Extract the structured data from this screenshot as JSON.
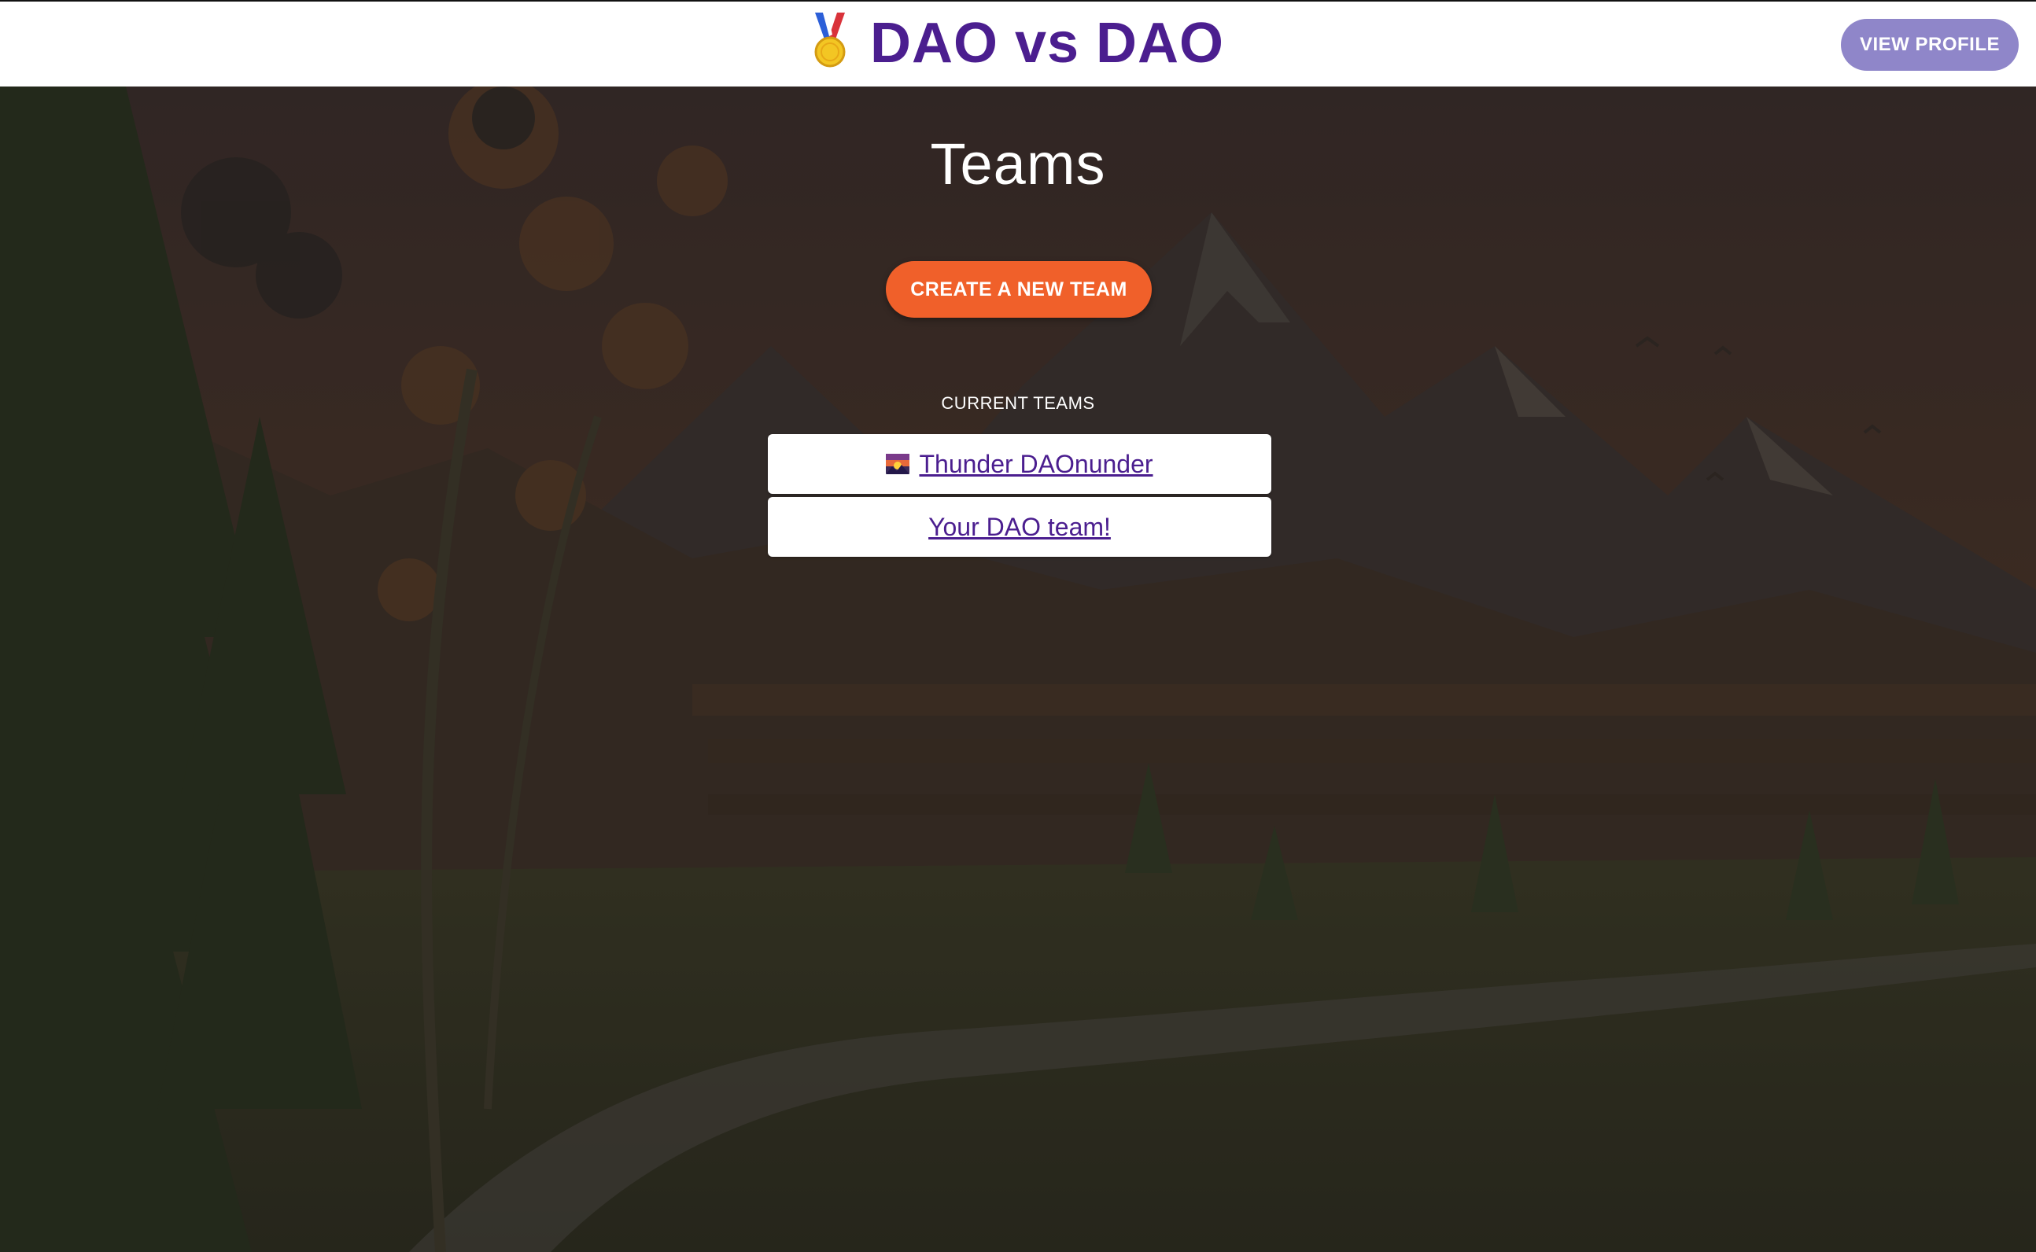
{
  "header": {
    "medal_icon": "medal-icon",
    "title": "DAO vs DAO",
    "view_profile_label": "VIEW PROFILE",
    "title_color": "#4b1e8f",
    "profile_button_color": "#8f86c9"
  },
  "main": {
    "page_title": "Teams",
    "create_button_label": "CREATE A NEW TEAM",
    "create_button_color": "#f0602a",
    "section_label": "CURRENT TEAMS",
    "teams": [
      {
        "icon": "sunset-landscape-icon",
        "name": "Thunder DAOnunder"
      },
      {
        "icon": "",
        "name": "Your DAO team!"
      }
    ]
  },
  "background": {
    "scene": "mountain-forest-illustration"
  }
}
